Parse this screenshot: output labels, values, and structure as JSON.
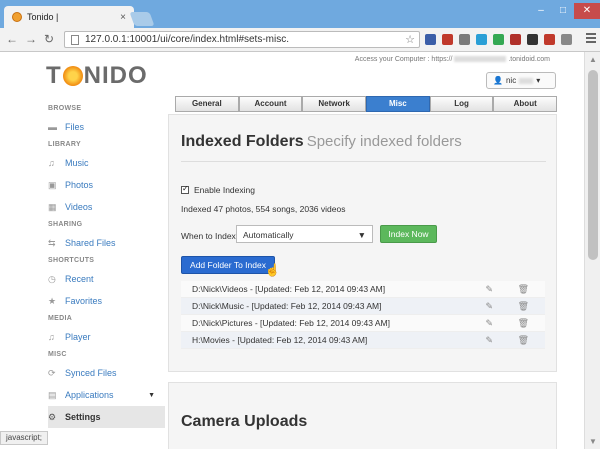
{
  "browser": {
    "tab_title": "Tonido | ",
    "tab_close": "×",
    "url": "127.0.0.1:10001/ui/core/index.html#sets-misc.",
    "nav_back": "←",
    "nav_forward": "→",
    "nav_reload": "↻",
    "window_min": "‒",
    "window_max": "□",
    "window_close": "✕",
    "status_text": "javascript;",
    "extension_colors": [
      "#3b5ea8",
      "#c0392b",
      "#7a7a7a",
      "#2a9fd6",
      "#34a853",
      "#b0302a",
      "#333333",
      "#c0392b",
      "#888888"
    ]
  },
  "logo": {
    "t": "T",
    "rest": "NIDO"
  },
  "header": {
    "access_text": "Access your Computer : https://",
    "access_suffix": ".tonidoid.com",
    "user_label": "nic",
    "user_caret": "▾"
  },
  "sidebar": {
    "sections": [
      {
        "header": "BROWSE",
        "items": [
          {
            "label": "Files",
            "icon": "folder-icon"
          }
        ]
      },
      {
        "header": "LIBRARY",
        "items": [
          {
            "label": "Music",
            "icon": "music-icon"
          },
          {
            "label": "Photos",
            "icon": "photo-icon"
          },
          {
            "label": "Videos",
            "icon": "video-icon"
          }
        ]
      },
      {
        "header": "SHARING",
        "items": [
          {
            "label": "Shared Files",
            "icon": "share-icon"
          }
        ]
      },
      {
        "header": "SHORTCUTS",
        "items": [
          {
            "label": "Recent",
            "icon": "clock-icon"
          },
          {
            "label": "Favorites",
            "icon": "star-icon"
          }
        ]
      },
      {
        "header": "MEDIA",
        "items": [
          {
            "label": "Player",
            "icon": "music-icon"
          }
        ]
      },
      {
        "header": "MISC",
        "items": [
          {
            "label": "Synced Files",
            "icon": "sync-icon"
          },
          {
            "label": "Applications",
            "icon": "apps-icon"
          },
          {
            "label": "Settings",
            "icon": "gear-icon"
          }
        ]
      }
    ]
  },
  "settings_tabs": [
    "General",
    "Account",
    "Network",
    "Misc",
    "Log",
    "About"
  ],
  "active_tab": "Misc",
  "indexed": {
    "title": "Indexed Folders",
    "subtitle": "Specify indexed folders",
    "enable_label": "Enable Indexing",
    "summary": "Indexed 47 photos, 554 songs, 2036 videos",
    "when_label": "When to Index:",
    "when_value": "Automatically",
    "index_now_label": "Index Now",
    "add_folder_label": "Add Folder To Index",
    "folders": [
      "D:\\Nick\\Videos - [Updated: Feb 12, 2014 09:43 AM]",
      "D:\\Nick\\Music - [Updated: Feb 12, 2014 09:43 AM]",
      "D:\\Nick\\Pictures - [Updated: Feb 12, 2014 09:43 AM]",
      "H:\\Movies - [Updated: Feb 12, 2014 09:43 AM]"
    ]
  },
  "camera": {
    "title": "Camera Uploads"
  }
}
